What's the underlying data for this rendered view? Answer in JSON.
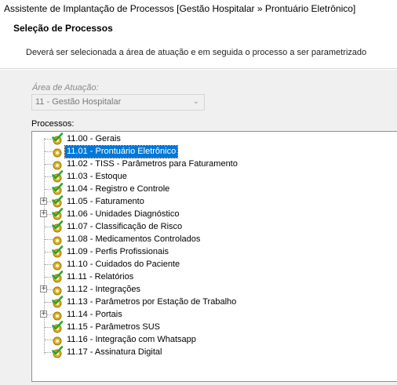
{
  "window": {
    "title": "Assistente de Implantação de Processos [Gestão Hospitalar » Prontuário Eletrônico]"
  },
  "header": {
    "title": "Seleção de Processos",
    "description": "Deverá ser selecionada a área de atuação e em seguida o processo a ser parametrizado"
  },
  "area": {
    "label": "Área de Atuação:",
    "value": "11 - Gestão Hospitalar"
  },
  "processes": {
    "label": "Processos:",
    "items": [
      {
        "label": "11.00 - Gerais",
        "expandable": false,
        "selected": false,
        "icon": "checked-process-icon"
      },
      {
        "label": "11.01 - Prontuário Eletrônico",
        "expandable": false,
        "selected": true,
        "icon": "process-icon"
      },
      {
        "label": "11.02 - TISS - Parâmetros para Faturamento",
        "expandable": false,
        "selected": false,
        "icon": "process-icon"
      },
      {
        "label": "11.03 - Estoque",
        "expandable": false,
        "selected": false,
        "icon": "checked-process-icon"
      },
      {
        "label": "11.04 - Registro e Controle",
        "expandable": false,
        "selected": false,
        "icon": "checked-process-icon"
      },
      {
        "label": "11.05 - Faturamento",
        "expandable": true,
        "selected": false,
        "icon": "checked-process-icon"
      },
      {
        "label": "11.06 - Unidades Diagnóstico",
        "expandable": true,
        "selected": false,
        "icon": "checked-process-icon"
      },
      {
        "label": "11.07 - Classificação de Risco",
        "expandable": false,
        "selected": false,
        "icon": "checked-process-icon"
      },
      {
        "label": "11.08 - Medicamentos Controlados",
        "expandable": false,
        "selected": false,
        "icon": "process-icon"
      },
      {
        "label": "11.09 - Perfis Profissionais",
        "expandable": false,
        "selected": false,
        "icon": "checked-process-icon"
      },
      {
        "label": "11.10 - Cuidados do Paciente",
        "expandable": false,
        "selected": false,
        "icon": "process-icon"
      },
      {
        "label": "11.11 - Relatórios",
        "expandable": false,
        "selected": false,
        "icon": "checked-process-icon"
      },
      {
        "label": "11.12 - Integrações",
        "expandable": true,
        "selected": false,
        "icon": "process-icon"
      },
      {
        "label": "11.13 - Parâmetros por Estação de Trabalho",
        "expandable": false,
        "selected": false,
        "icon": "checked-process-icon"
      },
      {
        "label": "11.14 - Portais",
        "expandable": true,
        "selected": false,
        "icon": "process-icon"
      },
      {
        "label": "11.15 - Parâmetros SUS",
        "expandable": false,
        "selected": false,
        "icon": "checked-process-icon"
      },
      {
        "label": "11.16 - Integração com Whatsapp",
        "expandable": false,
        "selected": false,
        "icon": "process-icon"
      },
      {
        "label": "11.17 - Assinatura Digital",
        "expandable": false,
        "selected": false,
        "icon": "checked-process-icon"
      }
    ]
  },
  "colors": {
    "selection": "#0078d7",
    "check": "#2aa52a",
    "gear": "#e0b020"
  }
}
